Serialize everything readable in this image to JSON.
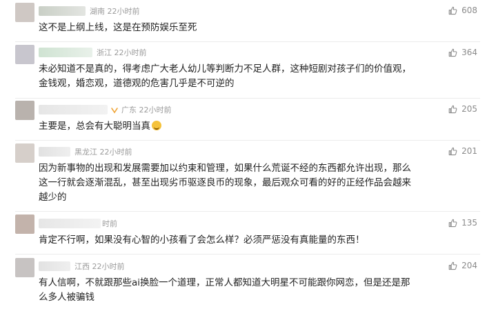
{
  "comments": [
    {
      "location": "湖南 22小时前",
      "likes": "608",
      "lines": [
        "这不是上纲上线，这是在预防娱乐至死"
      ]
    },
    {
      "location": "浙江 22小时前",
      "likes": "364",
      "lines": [
        "未必知道不是真的，得考虑广大老人幼儿等判断力不足人群，这种短剧对孩子们的价值观，",
        "金钱观，婚恋观，道德观的危害几乎是不可逆的"
      ]
    },
    {
      "location": "广东 22小时前",
      "likes": "205",
      "lines": [
        "主要是，总会有大聪明当真"
      ]
    },
    {
      "location": "黑龙江 22小时前",
      "likes": "201",
      "lines": [
        "因为新事物的出现和发展需要加以约束和管理，如果什么荒诞不经的东西都允许出现，那么",
        "这一行就会逐渐混乱，甚至出现劣币驱逐良币的现象，最后观众可看的好的正经作品会越来",
        "越少的"
      ]
    },
    {
      "location": "时前",
      "likes": "135",
      "lines": [
        "肯定不行啊，如果没有心智的小孩看了会怎么样？必须严惩没有真能量的东西！"
      ]
    },
    {
      "location": "江西 22小时前",
      "likes": "204",
      "lines": [
        "有人信啊，不就跟那些ai换脸一个道理，正常人都知道大明星不可能跟你网恋，但是还是那",
        "么多人被骗钱"
      ]
    }
  ]
}
